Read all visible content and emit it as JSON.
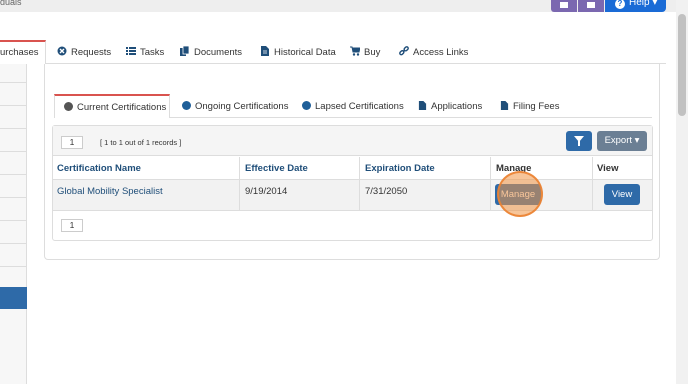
{
  "topbar": {
    "title_fragment": "duals",
    "help_label": "Help ▾"
  },
  "outer_tabs": [
    {
      "label": "urchases",
      "icon": "none",
      "active": true
    },
    {
      "label": "Requests",
      "icon": "x-circle-icon"
    },
    {
      "label": "Tasks",
      "icon": "list-icon"
    },
    {
      "label": "Documents",
      "icon": "copy-icon"
    },
    {
      "label": "Historical Data",
      "icon": "file-icon"
    },
    {
      "label": "Buy",
      "icon": "cart-icon"
    },
    {
      "label": "Access Links",
      "icon": "link-icon"
    }
  ],
  "inner_tabs": [
    {
      "label": "Current Certifications",
      "icon": "dot-icon",
      "active": true
    },
    {
      "label": "Ongoing Certifications",
      "icon": "dot-icon"
    },
    {
      "label": "Lapsed Certifications",
      "icon": "dot-icon"
    },
    {
      "label": "Applications",
      "icon": "file-icon"
    },
    {
      "label": "Filing Fees",
      "icon": "file-icon"
    }
  ],
  "grid": {
    "page_top": "1",
    "records_text": "[ 1 to 1 out of 1 records ]",
    "export_label": "Export ▾",
    "page_bottom": "1",
    "columns": [
      "Certification Name",
      "Effective Date",
      "Expiration Date",
      "Manage",
      "View"
    ],
    "rows": [
      {
        "name": "Global Mobility Specialist",
        "effective": "9/19/2014",
        "expiration": "7/31/2050",
        "manage_label": "Manage",
        "view_label": "View"
      }
    ]
  },
  "colors": {
    "primary": "#2e6aa8",
    "tab_accent": "#d9534f",
    "header_text": "#1f4e79",
    "export": "#6b7f94",
    "help": "#1a6bd6",
    "purple": "#7b68b0"
  }
}
